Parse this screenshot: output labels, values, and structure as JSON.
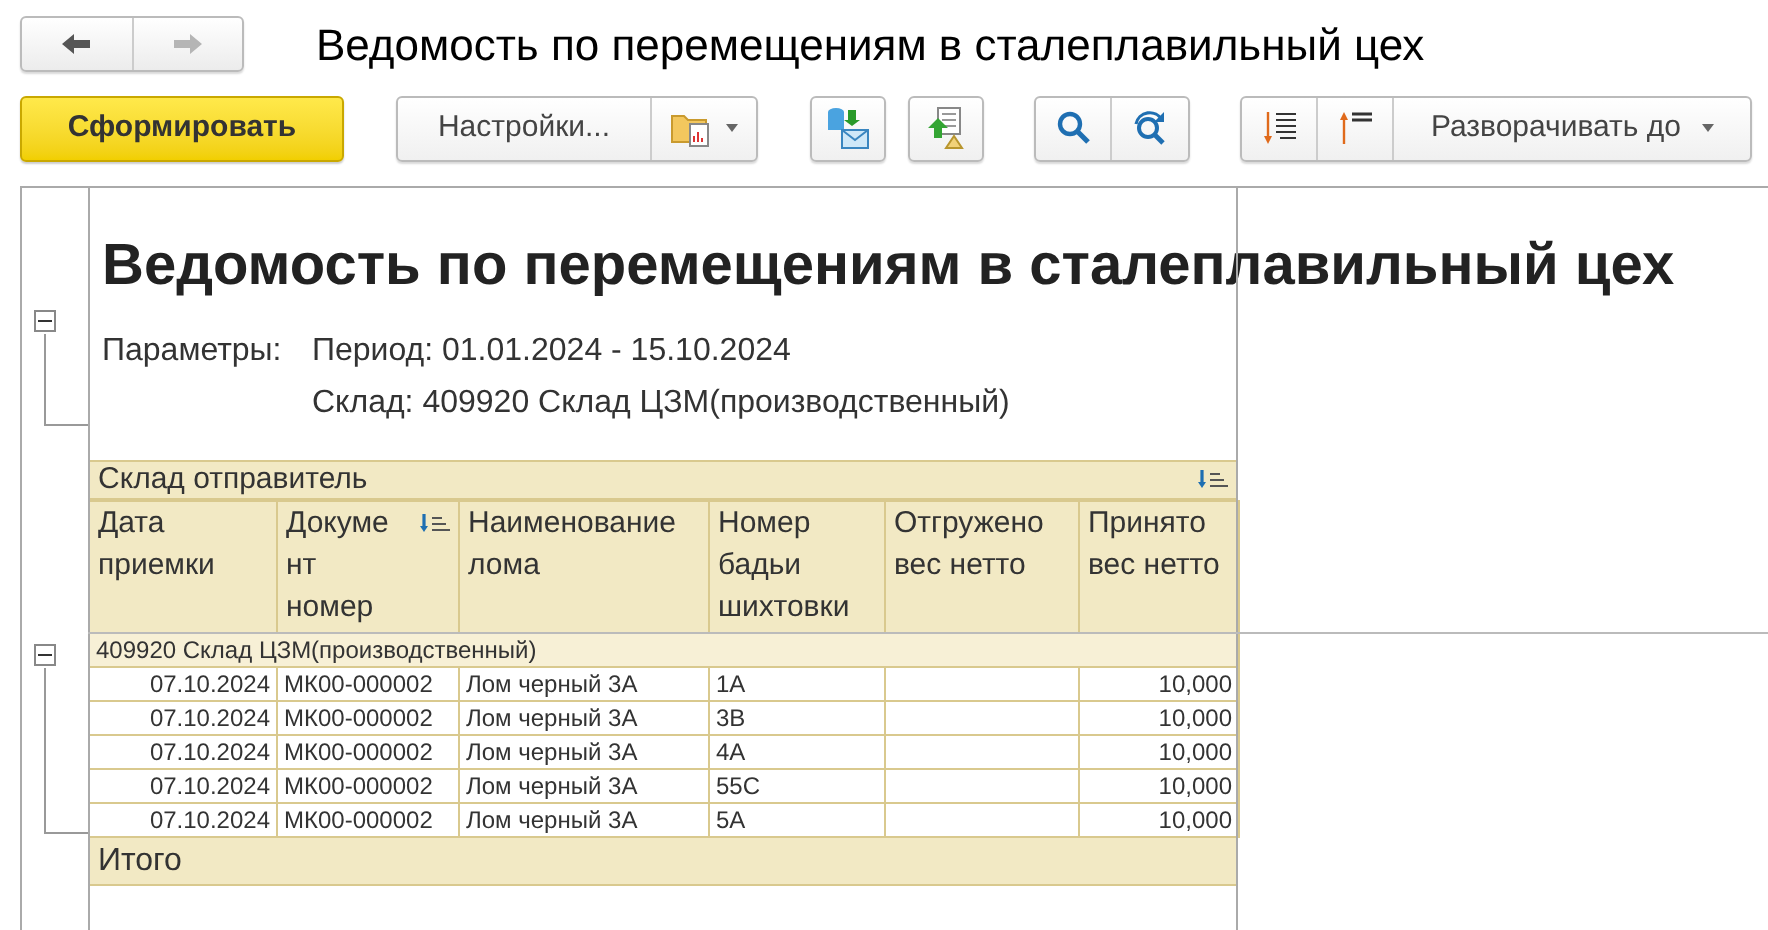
{
  "nav": [
    {
      "kind": "back",
      "disabled": false
    },
    {
      "kind": "forward",
      "disabled": true
    }
  ],
  "title": "Ведомость по перемещениям в сталеплавильный цех",
  "toolbar": {
    "generate_button": "Сформировать",
    "settings_button": "Настройки...",
    "expand_button": "Разворачивать до"
  },
  "report": {
    "title": "Ведомость по перемещениям в сталеплавильный цех",
    "parameters_label": "Параметры:",
    "parameters": [
      "Период: 01.01.2024 - 15.10.2024",
      "Склад: 409920 Склад ЦЗМ(производственный)"
    ],
    "group_header": "Склад отправитель",
    "columns": [
      {
        "label": "Дата приемки",
        "sorted": false
      },
      {
        "label": "Документ номер",
        "sorted": true
      },
      {
        "label": "Наименование лома",
        "sorted": false
      },
      {
        "label": "Номер бадьи шихтовки",
        "sorted": false
      },
      {
        "label": "Отгружено вес нетто",
        "sorted": false
      },
      {
        "label": "Принято вес нетто",
        "sorted": false
      }
    ],
    "group": {
      "label": "409920 Склад ЦЗМ(производственный)",
      "expanded": true,
      "rows": [
        {
          "date": "07.10.2024",
          "document": "МК00-000002",
          "scrap": "Лом черный 3А",
          "tub": "1А",
          "received": "10,000"
        },
        {
          "date": "07.10.2024",
          "document": "МК00-000002",
          "scrap": "Лом черный 3А",
          "tub": "3В",
          "received": "10,000"
        },
        {
          "date": "07.10.2024",
          "document": "МК00-000002",
          "scrap": "Лом черный 3А",
          "tub": "4А",
          "received": "10,000"
        },
        {
          "date": "07.10.2024",
          "document": "МК00-000002",
          "scrap": "Лом черный 3А",
          "tub": "55С",
          "received": "10,000"
        },
        {
          "date": "07.10.2024",
          "document": "МК00-000002",
          "scrap": "Лом черный 3А",
          "tub": "5А",
          "received": "10,000"
        }
      ]
    },
    "total": "Итого"
  }
}
